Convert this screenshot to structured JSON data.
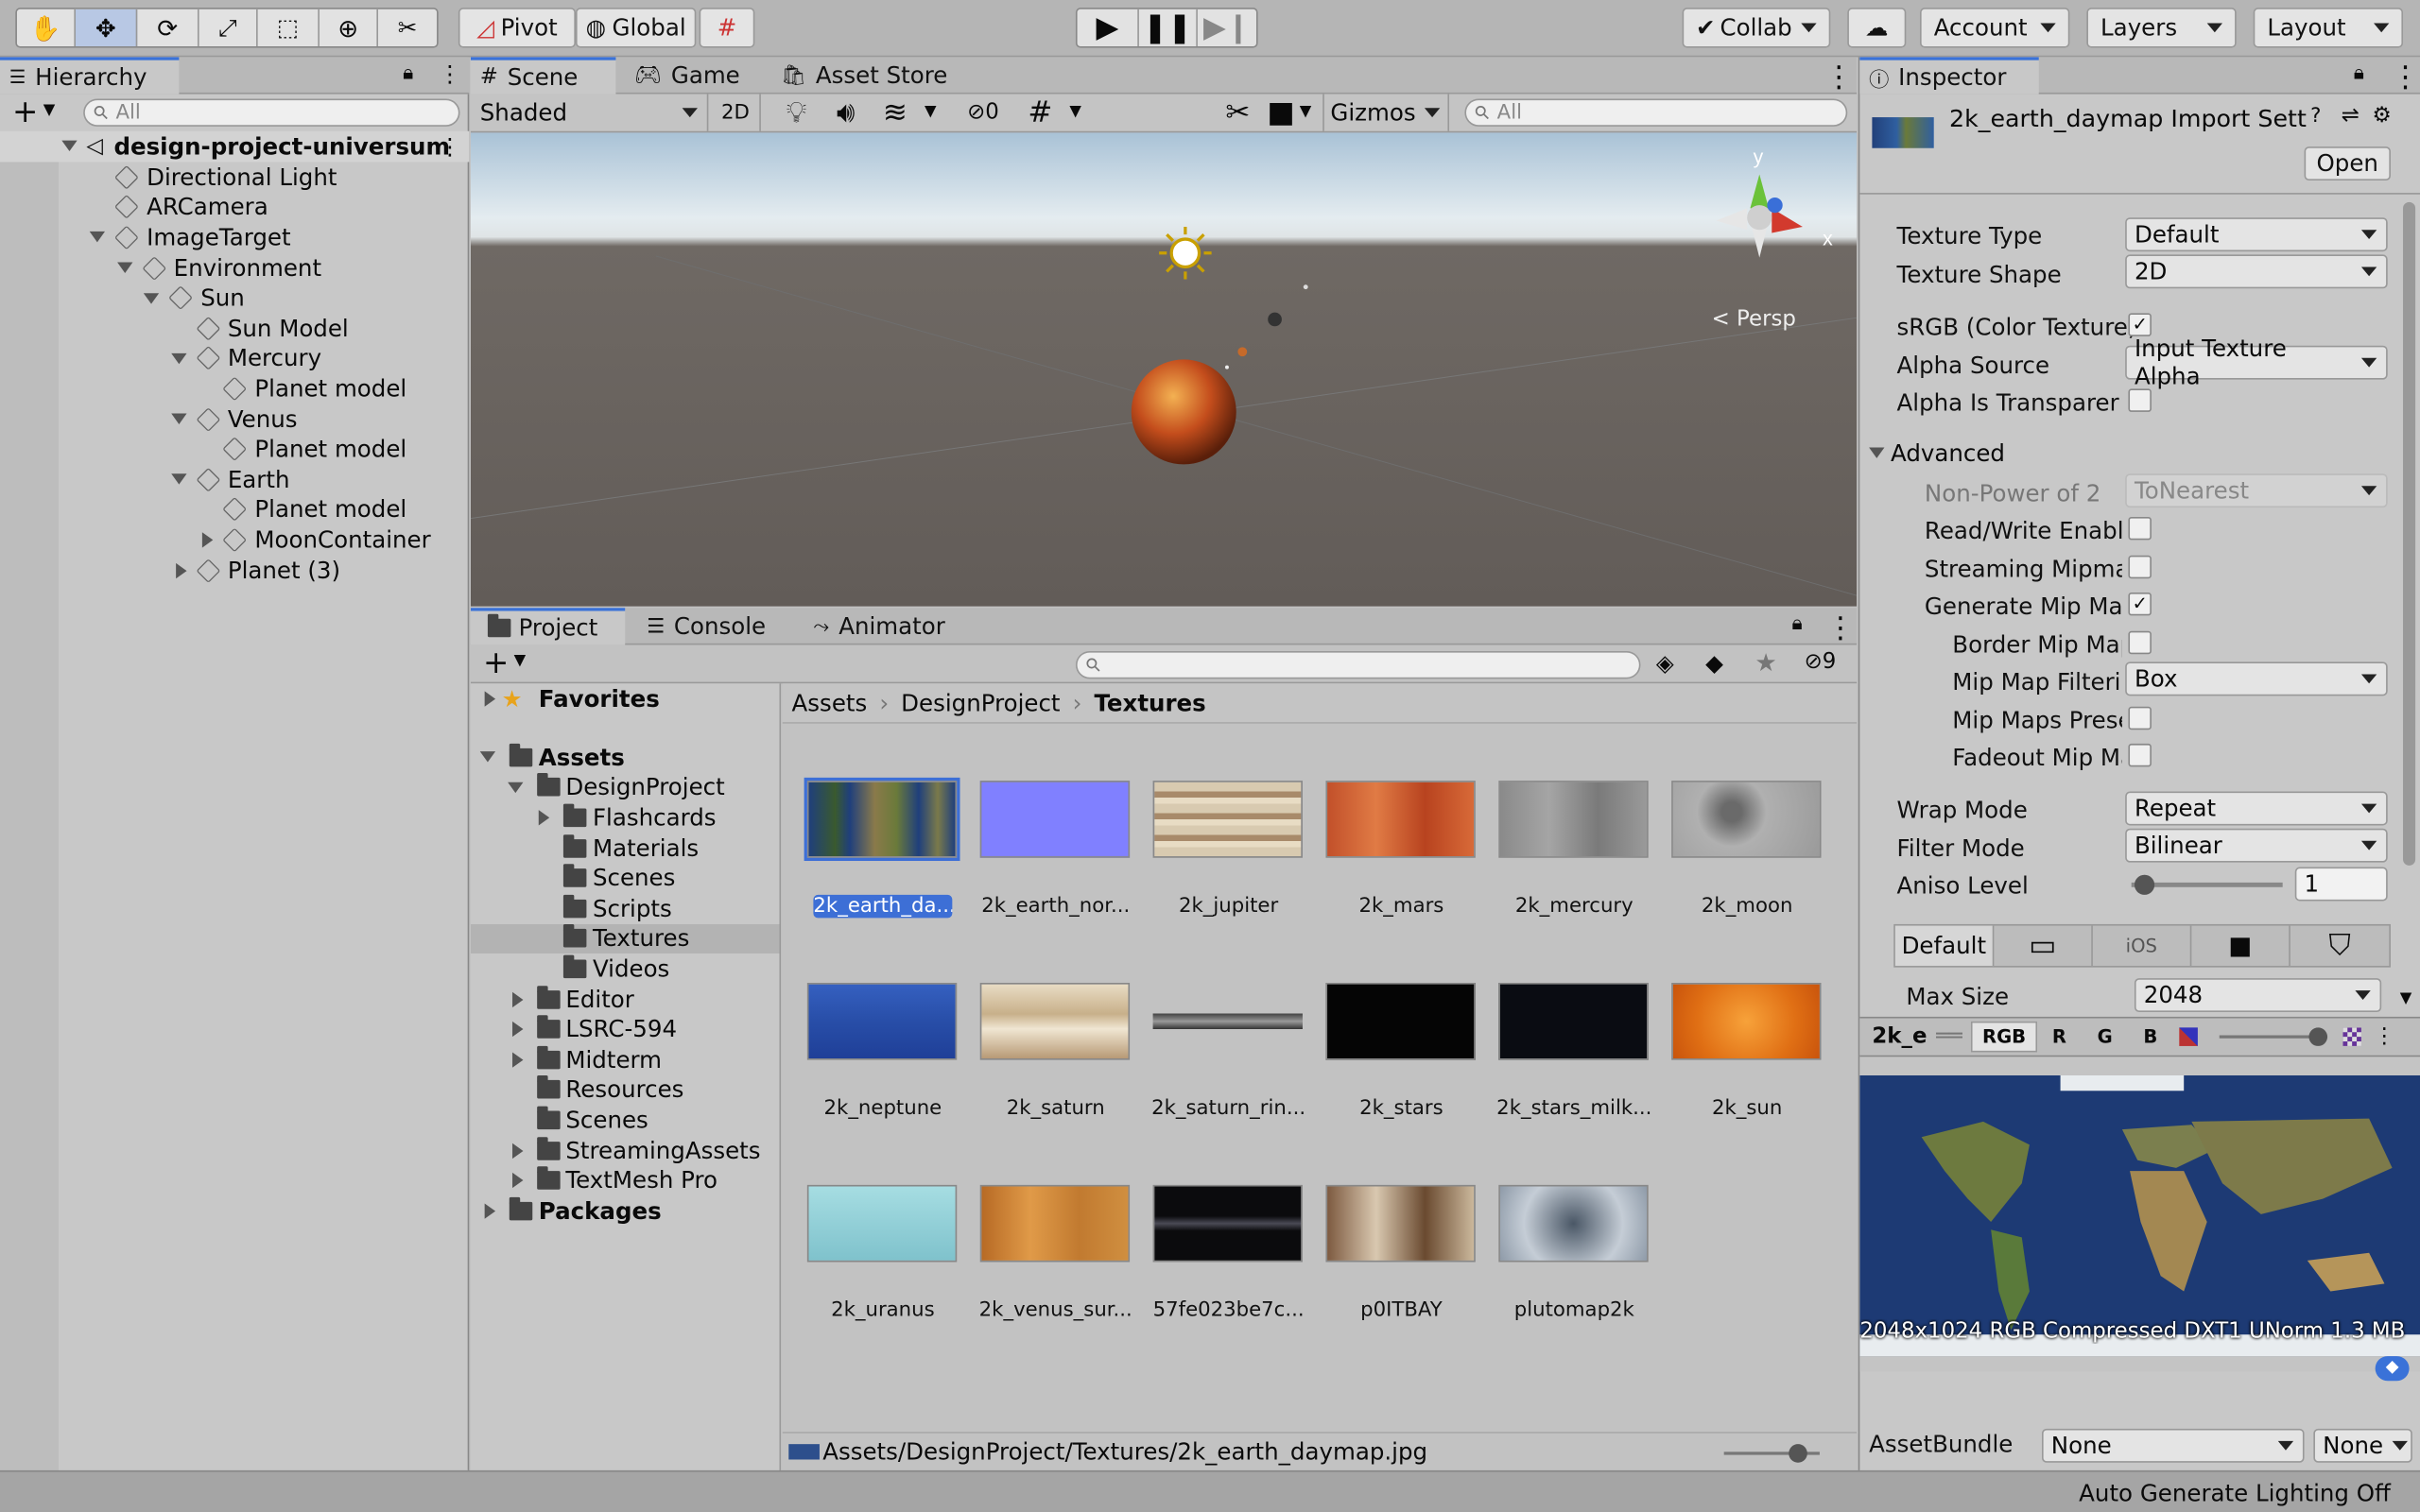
{
  "toolbar": {
    "pivot": "Pivot",
    "global": "Global",
    "collab": "Collab",
    "account": "Account",
    "layers": "Layers",
    "layout": "Layout"
  },
  "hierarchy": {
    "tab": "Hierarchy",
    "search_placeholder": "All",
    "scene": "design-project-universum",
    "items": [
      {
        "label": "Directional Light",
        "indent": 0,
        "arrow": ""
      },
      {
        "label": "ARCamera",
        "indent": 0,
        "arrow": ""
      },
      {
        "label": "ImageTarget",
        "indent": 0,
        "arrow": "down"
      },
      {
        "label": "Environment",
        "indent": 1,
        "arrow": "down"
      },
      {
        "label": "Sun",
        "indent": 2,
        "arrow": "down"
      },
      {
        "label": "Sun Model",
        "indent": 3,
        "arrow": ""
      },
      {
        "label": "Mercury",
        "indent": 3,
        "arrow": "down"
      },
      {
        "label": "Planet model",
        "indent": 4,
        "arrow": ""
      },
      {
        "label": "Venus",
        "indent": 3,
        "arrow": "down"
      },
      {
        "label": "Planet model",
        "indent": 4,
        "arrow": ""
      },
      {
        "label": "Earth",
        "indent": 3,
        "arrow": "down"
      },
      {
        "label": "Planet model",
        "indent": 4,
        "arrow": ""
      },
      {
        "label": "MoonContainer",
        "indent": 4,
        "arrow": "right"
      },
      {
        "label": "Planet (3)",
        "indent": 3,
        "arrow": "right"
      }
    ]
  },
  "scene": {
    "tabs": [
      "Scene",
      "Game",
      "Asset Store"
    ],
    "shading": "Shaded",
    "mode2d": "2D",
    "hidden_count": "0",
    "gizmos": "Gizmos",
    "search_placeholder": "All",
    "persp": "Persp",
    "axis_y": "y",
    "axis_x": "x"
  },
  "project": {
    "tabs": [
      "Project",
      "Console",
      "Animator"
    ],
    "hidden_count": "9",
    "tree": [
      {
        "label": "Favorites",
        "indent": 0,
        "arrow": "right",
        "bold": true,
        "type": "star"
      },
      {
        "label": "Assets",
        "indent": 0,
        "arrow": "down",
        "bold": true,
        "type": "folder"
      },
      {
        "label": "DesignProject",
        "indent": 1,
        "arrow": "down",
        "type": "folder"
      },
      {
        "label": "Flashcards",
        "indent": 2,
        "arrow": "right",
        "type": "folder"
      },
      {
        "label": "Materials",
        "indent": 2,
        "arrow": "",
        "type": "folder"
      },
      {
        "label": "Scenes",
        "indent": 2,
        "arrow": "",
        "type": "folder"
      },
      {
        "label": "Scripts",
        "indent": 2,
        "arrow": "",
        "type": "folder"
      },
      {
        "label": "Textures",
        "indent": 2,
        "arrow": "",
        "type": "folder",
        "selected": true
      },
      {
        "label": "Videos",
        "indent": 2,
        "arrow": "",
        "type": "folder"
      },
      {
        "label": "Editor",
        "indent": 1,
        "arrow": "right",
        "type": "folder"
      },
      {
        "label": "LSRC-594",
        "indent": 1,
        "arrow": "right",
        "type": "folder"
      },
      {
        "label": "Midterm",
        "indent": 1,
        "arrow": "right",
        "type": "folder"
      },
      {
        "label": "Resources",
        "indent": 1,
        "arrow": "",
        "type": "folder"
      },
      {
        "label": "Scenes",
        "indent": 1,
        "arrow": "",
        "type": "folder"
      },
      {
        "label": "StreamingAssets",
        "indent": 1,
        "arrow": "right",
        "type": "folder"
      },
      {
        "label": "TextMesh Pro",
        "indent": 1,
        "arrow": "right",
        "type": "folder"
      },
      {
        "label": "Packages",
        "indent": 0,
        "arrow": "right",
        "bold": true,
        "type": "folder"
      }
    ],
    "breadcrumb": [
      "Assets",
      "DesignProject",
      "Textures"
    ],
    "assets": [
      {
        "name": "2k_earth_da...",
        "fill": "earth",
        "selected": true
      },
      {
        "name": "2k_earth_nor...",
        "fill": "#8080ff"
      },
      {
        "name": "2k_jupiter",
        "fill": "jupiter"
      },
      {
        "name": "2k_mars",
        "fill": "mars"
      },
      {
        "name": "2k_mercury",
        "fill": "mercury"
      },
      {
        "name": "2k_moon",
        "fill": "moon"
      },
      {
        "name": "2k_neptune",
        "fill": "neptune"
      },
      {
        "name": "2k_saturn",
        "fill": "saturn"
      },
      {
        "name": "2k_saturn_rin...",
        "fill": "ring"
      },
      {
        "name": "2k_stars",
        "fill": "#050505"
      },
      {
        "name": "2k_stars_milk...",
        "fill": "#0a0c12"
      },
      {
        "name": "2k_sun",
        "fill": "sun"
      },
      {
        "name": "2k_uranus",
        "fill": "uranus"
      },
      {
        "name": "2k_venus_sur...",
        "fill": "venus"
      },
      {
        "name": "57fe023be7c...",
        "fill": "galaxy"
      },
      {
        "name": "p0ITBAY",
        "fill": "pbay"
      },
      {
        "name": "plutomap2k",
        "fill": "pluto"
      }
    ],
    "status_path": "Assets/DesignProject/Textures/2k_earth_daymap.jpg"
  },
  "inspector": {
    "tab": "Inspector",
    "title": "2k_earth_daymap Import Sett",
    "open": "Open",
    "texture_type_label": "Texture Type",
    "texture_type": "Default",
    "texture_shape_label": "Texture Shape",
    "texture_shape": "2D",
    "srgb_label": "sRGB (Color Texture)",
    "alpha_source_label": "Alpha Source",
    "alpha_source": "Input Texture Alpha",
    "alpha_transp_label": "Alpha Is Transparenc",
    "advanced": "Advanced",
    "npot_label": "Non-Power of 2",
    "npot": "ToNearest",
    "rw_label": "Read/Write Enable",
    "stream_label": "Streaming Mipmap",
    "genmip_label": "Generate Mip Map",
    "border_label": "Border Mip Map",
    "mipfilter_label": "Mip Map Filterin",
    "mipfilter": "Box",
    "mippreserve_label": "Mip Maps Prese",
    "fadeout_label": "Fadeout Mip Ma",
    "wrap_label": "Wrap Mode",
    "wrap": "Repeat",
    "filter_label": "Filter Mode",
    "filter": "Bilinear",
    "aniso_label": "Aniso Level",
    "aniso": "1",
    "aniso_fraction": 0.08,
    "platform_default": "Default",
    "platform_ios": "iOS",
    "maxsize_label": "Max Size",
    "maxsize": "2048",
    "preview_name": "2k_e",
    "channels": [
      "RGB",
      "R",
      "G",
      "B"
    ],
    "preview_info": "2048x1024  RGB Compressed DXT1 UNorm   1.3 MB",
    "assetbundle_label": "AssetBundle",
    "assetbundle": "None",
    "assetbundle_variant": "None"
  },
  "statusbar": {
    "lighting": "Auto Generate Lighting Off"
  },
  "colors": {
    "accent": "#3a72d8",
    "selection": "#3d6fd6"
  }
}
